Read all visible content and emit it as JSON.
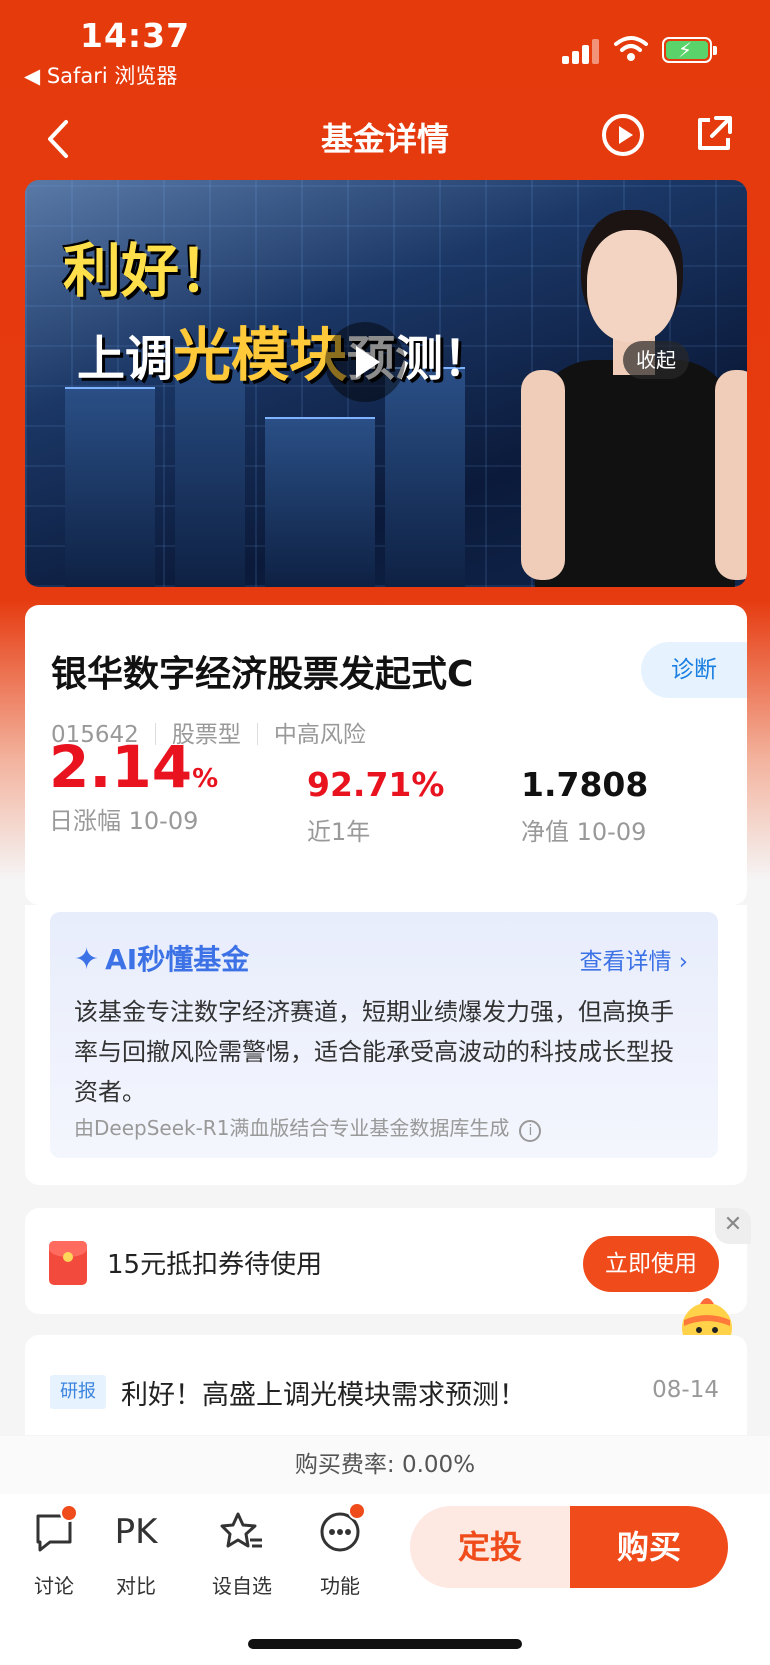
{
  "status_bar": {
    "time": "14:37",
    "back_app": "◀ Safari 浏览器"
  },
  "nav": {
    "title": "基金详情"
  },
  "video": {
    "headline_1": "利好！",
    "headline_2a": "上调",
    "headline_2b": "光模块",
    "headline_2c": "预测！",
    "collapse_label": "收起"
  },
  "fund": {
    "name": "银华数字经济股票发起式C",
    "code": "015642",
    "type": "股票型",
    "risk": "中高风险",
    "diagnose_label": "诊断",
    "daily_change": "2.14",
    "daily_change_unit": "%",
    "daily_change_label": "日涨幅 10-09",
    "year_return": "92.71%",
    "year_return_label": "近1年",
    "nav_value": "1.7808",
    "nav_label": "净值 10-09"
  },
  "ai": {
    "title": "AI秒懂基金",
    "more": "查看详情 ›",
    "summary": "该基金专注数字经济赛道，短期业绩爆发力强，但高换手率与回撤风险需警惕，适合能承受高波动的科技成长型投资者。",
    "footer": "由DeepSeek-R1满血版结合专业基金数据库生成"
  },
  "coupon": {
    "text": "15元抵扣券待使用",
    "button": "立即使用"
  },
  "news": {
    "tag": "研报",
    "title": "利好！高盛上调光模块需求预测！",
    "date": "08-14"
  },
  "fee": "购买费率: 0.00%",
  "toolbar": {
    "discuss": "讨论",
    "pk_icon_text": "PK",
    "compare": "对比",
    "watchlist": "设自选",
    "functions": "功能",
    "dingtou": "定投",
    "buy": "购买"
  },
  "colors": {
    "brand_orange": "#f04b1b",
    "rise_red": "#e8131f",
    "ai_blue": "#3c72e6"
  }
}
